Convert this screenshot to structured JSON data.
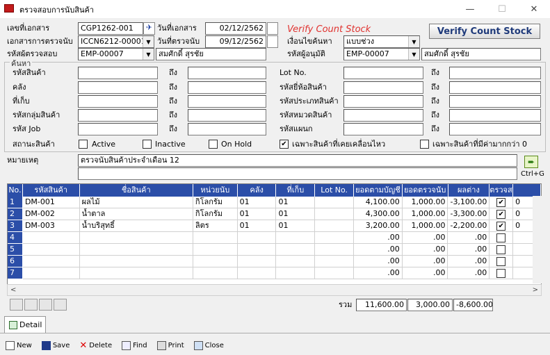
{
  "window": {
    "title": "ตรวจสอบการนับสินค้า"
  },
  "header": {
    "doc_no_label": "เลขที่เอกสาร",
    "doc_no": "CGP1262-001",
    "count_doc_label": "เอกสารการตรวจนับ",
    "count_doc": "ICCN6212-00001",
    "inspector_label": "รหัสผู้ตรวจสอบ",
    "inspector_code": "EMP-00007",
    "inspector_name": "สมศักดิ์ สุรชัย",
    "doc_date_label": "วันที่เอกสาร",
    "doc_date": "02/12/2562",
    "count_date_label": "วันที่ตรวจนับ",
    "count_date": "09/12/2562",
    "condition_label": "เงื่อนไขค้นหา",
    "condition_value": "แบบช่วง",
    "approver_label": "รหัสผู้อนุมัติ",
    "approver_code": "EMP-00007",
    "approver_name": "สมศักดิ์ สุรชัย",
    "banner": "Verify Count Stock",
    "verify_button": "Verify Count Stock"
  },
  "search": {
    "legend": "ค้นหา",
    "to": "ถึง",
    "product_code": "รหัสสินค้า",
    "warehouse": "คลัง",
    "location": "ที่เก็บ",
    "product_group": "รหัสกลุ่มสินค้า",
    "job": "รหัส Job",
    "lot_no": "Lot No.",
    "brand": "รหัสยี่ห้อสินค้า",
    "product_type": "รหัสประเภทสินค้า",
    "category": "รหัสหมวดสินค้า",
    "department": "รหัสแผนก",
    "status_label": "สถานะสินค้า",
    "active": "Active",
    "inactive": "Inactive",
    "onhold": "On Hold",
    "moved_only": "เฉพาะสินค้าที่เคยเคลื่อนไหว",
    "over_zero": "เฉพาะสินค้าที่มีค่ามากกว่า 0"
  },
  "remark": {
    "label": "หมายเหตุ",
    "value": "ตรวจนับสินค้าประจำเดือน 12",
    "shortcut": "Ctrl+G"
  },
  "grid": {
    "columns": [
      "No.",
      "รหัสสินค้า",
      "ชื่อสินค้า",
      "หน่วยนับ",
      "คลัง",
      "ที่เก็บ",
      "Lot No.",
      "ยอดตามบัญชี",
      "ยอดตรวจนับ",
      "ผลต่าง",
      "ตรวจสอบ"
    ],
    "rows": [
      {
        "no": "1",
        "code": "DM-001",
        "name": "ผลไม้",
        "unit": "กิโลกรัม",
        "wh": "01",
        "loc": "01",
        "lot": "",
        "book": "4,100.00",
        "count": "1,000.00",
        "diff": "-3,100.00",
        "checked": "✔"
      },
      {
        "no": "2",
        "code": "DM-002",
        "name": "น้ำตาล",
        "unit": "กิโลกรัม",
        "wh": "01",
        "loc": "01",
        "lot": "",
        "book": "4,300.00",
        "count": "1,000.00",
        "diff": "-3,300.00",
        "checked": "✔"
      },
      {
        "no": "3",
        "code": "DM-003",
        "name": "น้ำบริสุทธิ์",
        "unit": "ลิตร",
        "wh": "01",
        "loc": "01",
        "lot": "",
        "book": "3,200.00",
        "count": "1,000.00",
        "diff": "-2,200.00",
        "checked": "✔"
      },
      {
        "no": "4",
        "code": "",
        "name": "",
        "unit": "",
        "wh": "",
        "loc": "",
        "lot": "",
        "book": ".00",
        "count": ".00",
        "diff": ".00",
        "checked": ""
      },
      {
        "no": "5",
        "code": "",
        "name": "",
        "unit": "",
        "wh": "",
        "loc": "",
        "lot": "",
        "book": ".00",
        "count": ".00",
        "diff": ".00",
        "checked": ""
      },
      {
        "no": "6",
        "code": "",
        "name": "",
        "unit": "",
        "wh": "",
        "loc": "",
        "lot": "",
        "book": ".00",
        "count": ".00",
        "diff": ".00",
        "checked": ""
      },
      {
        "no": "7",
        "code": "",
        "name": "",
        "unit": "",
        "wh": "",
        "loc": "",
        "lot": "",
        "book": ".00",
        "count": ".00",
        "diff": ".00",
        "checked": ""
      }
    ],
    "last_col_clip": "0"
  },
  "totals": {
    "label": "รวม",
    "book": "11,600.00",
    "count": "3,000.00",
    "diff": "-8,600.00"
  },
  "tabs": {
    "detail": "Detail"
  },
  "toolbar": {
    "new": "New",
    "save": "Save",
    "delete": "Delete",
    "find": "Find",
    "print": "Print",
    "close": "Close"
  }
}
